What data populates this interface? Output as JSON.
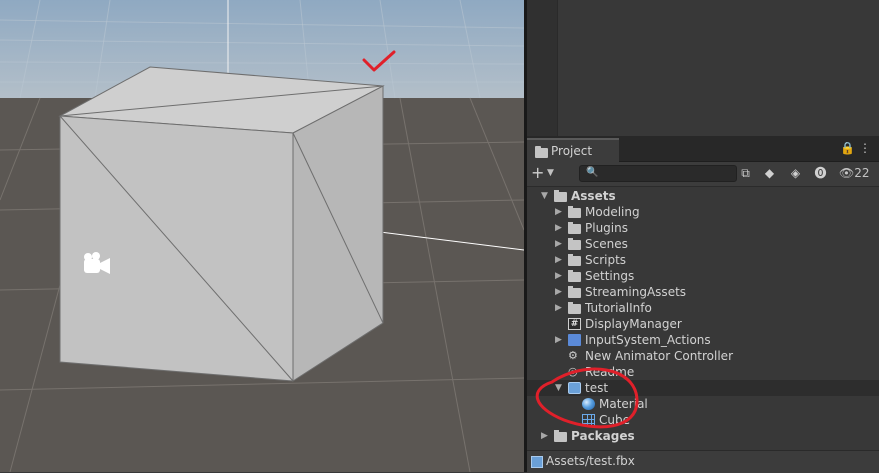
{
  "project_panel": {
    "tab_label": "Project",
    "hidden_count": "22",
    "tree": [
      {
        "label": "Assets",
        "indent": 0,
        "expanded": true,
        "icon": "folder-open-icon",
        "bold": true
      },
      {
        "label": "Modeling",
        "indent": 1,
        "expanded": false,
        "icon": "folder-icon"
      },
      {
        "label": "Plugins",
        "indent": 1,
        "expanded": false,
        "icon": "folder-icon"
      },
      {
        "label": "Scenes",
        "indent": 1,
        "expanded": false,
        "icon": "folder-icon"
      },
      {
        "label": "Scripts",
        "indent": 1,
        "expanded": false,
        "icon": "folder-icon"
      },
      {
        "label": "Settings",
        "indent": 1,
        "expanded": false,
        "icon": "folder-icon"
      },
      {
        "label": "StreamingAssets",
        "indent": 1,
        "expanded": false,
        "icon": "folder-icon"
      },
      {
        "label": "TutorialInfo",
        "indent": 1,
        "expanded": false,
        "icon": "folder-icon"
      },
      {
        "label": "DisplayManager",
        "indent": 1,
        "expanded": null,
        "icon": "script-icon"
      },
      {
        "label": "InputSystem_Actions",
        "indent": 1,
        "expanded": false,
        "icon": "input-actions-icon"
      },
      {
        "label": "New Animator Controller",
        "indent": 1,
        "expanded": null,
        "icon": "animator-icon"
      },
      {
        "label": "Readme",
        "indent": 1,
        "expanded": null,
        "icon": "readme-icon"
      },
      {
        "label": "test",
        "indent": 1,
        "expanded": true,
        "icon": "model-icon",
        "selected": true
      },
      {
        "label": "Material",
        "indent": 2,
        "expanded": null,
        "icon": "material-icon"
      },
      {
        "label": "Cube",
        "indent": 2,
        "expanded": null,
        "icon": "mesh-icon"
      },
      {
        "label": "Packages",
        "indent": 0,
        "expanded": false,
        "icon": "folder-icon",
        "bold": true
      }
    ],
    "status_path": "Assets/test.fbx"
  },
  "colors": {
    "annotation": "#e0202a",
    "panel_bg": "#383838",
    "selection": "#2d2d2d"
  }
}
